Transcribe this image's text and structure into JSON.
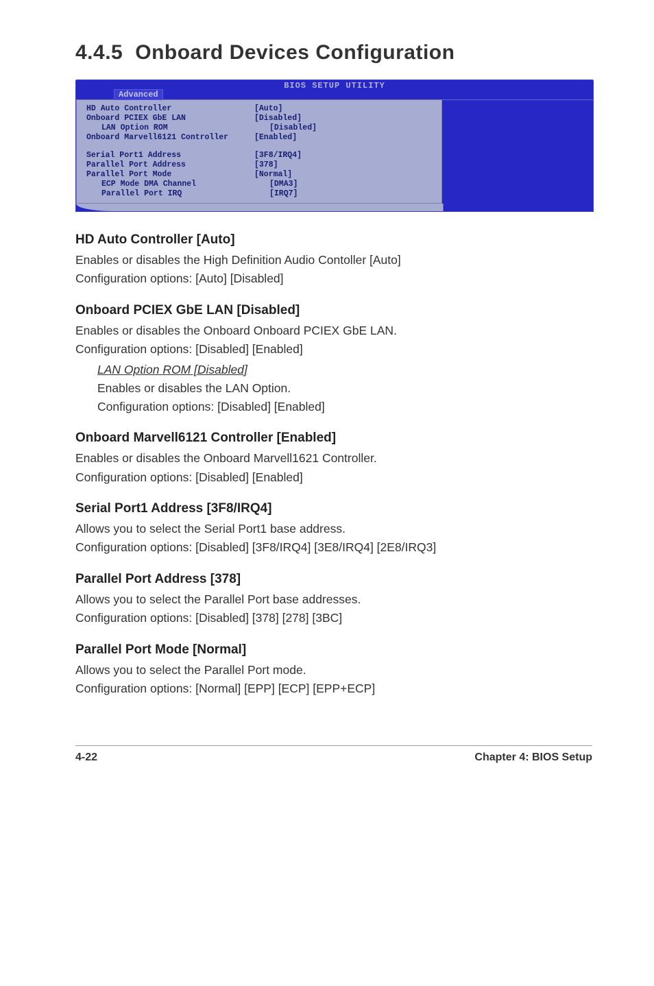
{
  "section": {
    "number": "4.4.5",
    "title": "Onboard Devices Configuration"
  },
  "bios": {
    "header": "BIOS SETUP UTILITY",
    "tab": "Advanced",
    "rows": [
      {
        "label": "HD Auto Controller",
        "value": "[Auto]",
        "indent": false
      },
      {
        "label": "Onboard PCIEX GbE LAN",
        "value": "[Disabled]",
        "indent": false
      },
      {
        "label": "LAN Option ROM",
        "value": "[Disabled]",
        "indent": true
      },
      {
        "label": "Onboard Marvell6121 Controller",
        "value": "[Enabled]",
        "indent": false
      }
    ],
    "rows2": [
      {
        "label": "Serial Port1 Address",
        "value": "[3F8/IRQ4]",
        "indent": false
      },
      {
        "label": "Parallel Port Address",
        "value": "[378]",
        "indent": false
      },
      {
        "label": "Parallel Port Mode",
        "value": "[Normal]",
        "indent": false
      },
      {
        "label": "ECP Mode DMA Channel",
        "value": "[DMA3]",
        "indent": true
      },
      {
        "label": "Parallel Port IRQ",
        "value": "[IRQ7]",
        "indent": true
      }
    ],
    "right_footer": {
      "left": "",
      "right": ""
    }
  },
  "items": [
    {
      "heading": "HD Auto Controller [Auto]",
      "p1": "Enables or disables the High Definition Audio Contoller [Auto]",
      "p2": "Configuration options: [Auto] [Disabled]"
    },
    {
      "heading": "Onboard PCIEX GbE LAN [Disabled]",
      "p1": "Enables or disables the Onboard Onboard PCIEX GbE LAN.",
      "p2": "Configuration options: [Disabled] [Enabled]",
      "sub": {
        "title": "LAN Option ROM [Disabled]",
        "p1": "Enables or disables the LAN Option.",
        "p2": "Configuration options: [Disabled] [Enabled]"
      }
    },
    {
      "heading": "Onboard Marvell6121 Controller [Enabled]",
      "p1": "Enables or disables the Onboard Marvell1621 Controller.",
      "p2": "Configuration options: [Disabled] [Enabled]"
    },
    {
      "heading": "Serial Port1 Address [3F8/IRQ4]",
      "p1": "Allows you to select the Serial Port1 base address.",
      "p2": "Configuration options: [Disabled] [3F8/IRQ4] [3E8/IRQ4] [2E8/IRQ3]"
    },
    {
      "heading": "Parallel Port Address [378]",
      "p1": "Allows you to select the Parallel Port base addresses.",
      "p2": "Configuration options: [Disabled] [378] [278] [3BC]"
    },
    {
      "heading": "Parallel Port Mode [Normal]",
      "p1": "Allows you to select the Parallel Port mode.",
      "p2": "Configuration options: [Normal] [EPP] [ECP] [EPP+ECP]"
    }
  ],
  "footer": {
    "left": "4-22",
    "right": "Chapter 4: BIOS Setup"
  }
}
